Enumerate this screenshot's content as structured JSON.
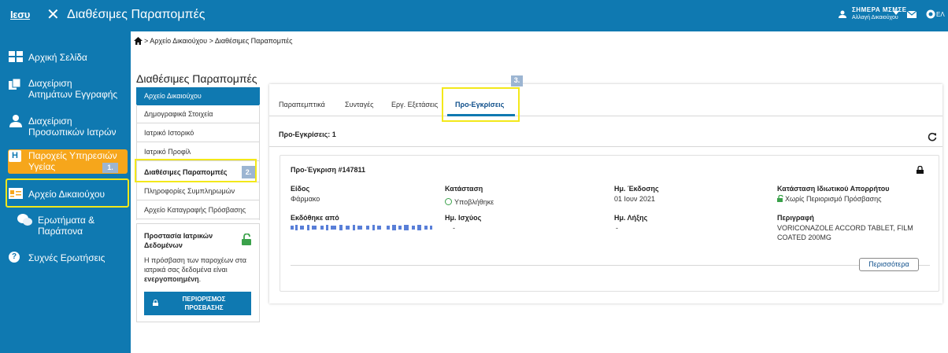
{
  "header": {
    "logo_text": "Ιεσυ",
    "title": "Διαθέσιμες Παραπομπές",
    "user_name": "ΣΗΜΕΡΑ ΜΣΜΣΕ",
    "user_sub": "Αλλαγή Δικαιούχου",
    "lang": "ΕΛ"
  },
  "sidebar": {
    "items": [
      {
        "label": "Αρχική Σελίδα"
      },
      {
        "label_line1": "Διαχείριση",
        "label_line2": "Αιτημάτων Εγγραφής"
      },
      {
        "label_line1": "Διαχείριση",
        "label_line2": "Προσωπικών Ιατρών"
      },
      {
        "label_line1": "Παροχείς Υπηρεσιών",
        "label_line2": "Υγείας"
      },
      {
        "label": "Αρχείο Δικαιούχου"
      },
      {
        "label_line1": "Ερωτήματα &",
        "label_line2": "Παράπονα"
      },
      {
        "label": "Συχνές Ερωτήσεις"
      }
    ],
    "step1": "1."
  },
  "breadcrumb": "> Αρχείο Δικαιούχου > Διαθέσιμες Παραπομπές",
  "section_title": "Διαθέσιμες Παραπομπές",
  "submenu": {
    "items": [
      "Αρχείο Δικαιούχου",
      "Δημογραφικά Στοιχεία",
      "Ιατρικό Ιστορικό",
      "Ιατρικό Προφίλ",
      "Διαθέσιμες Παραπομπές",
      "Πληροφορίες Συμπληρωμών",
      "Αρχείο Καταγραφής Πρόσβασης"
    ],
    "step2": "2."
  },
  "protection": {
    "title": "Προστασία Ιατρικών Δεδομένων",
    "text_plain": "Η πρόσβαση των παροχέων στα ιατρικά σας δεδομένα είναι",
    "text_bold": "ενεργοποιημένη",
    "text_end": ".",
    "button_line1": "ΠΕΡΙΟΡΙΣΜΟΣ",
    "button_line2": "ΠΡΟΣΒΑΣΗΣ"
  },
  "tabs": {
    "items": [
      "Παραπεμπτικά",
      "Συνταγές",
      "Εργ. Εξετάσεις",
      "Προ-Εγκρίσεις"
    ],
    "active": "Προ-Εγκρίσεις",
    "step3": "3."
  },
  "list": {
    "count_title": "Προ-Εγκρίσεις: 1"
  },
  "card": {
    "title": "Προ-Έγκριση #147811",
    "eidos_label": "Είδος",
    "eidos_value": "Φάρμακο",
    "status_label": "Κατάσταση",
    "status_value": "Υποβλήθηκε",
    "issue_label": "Ημ. Έκδοσης",
    "issue_value": "01 Ιουν 2021",
    "privacy_label": "Κατάσταση Ιδιωτικού Απορρήτου",
    "privacy_value": "Χωρίς Περιορισμό Πρόσβασης",
    "issued_by_label": "Εκδόθηκε από",
    "valid_label": "Ημ. Ισχύος",
    "valid_value": "-",
    "expiry_label": "Ημ. Λήξης",
    "expiry_value": "-",
    "desc_label": "Περιγραφή",
    "desc_value_line1": "VORICONAZOLE ACCORD TABLET, FILM",
    "desc_value_line2": "COATED 200MG",
    "more_button": "Περισσότερα"
  },
  "colors": {
    "primary": "#0f79b1",
    "accent_orange": "#f6a61b",
    "highlight_yellow": "#f3e81a",
    "badge": "#9cb5d2",
    "success": "#3aa14a"
  }
}
